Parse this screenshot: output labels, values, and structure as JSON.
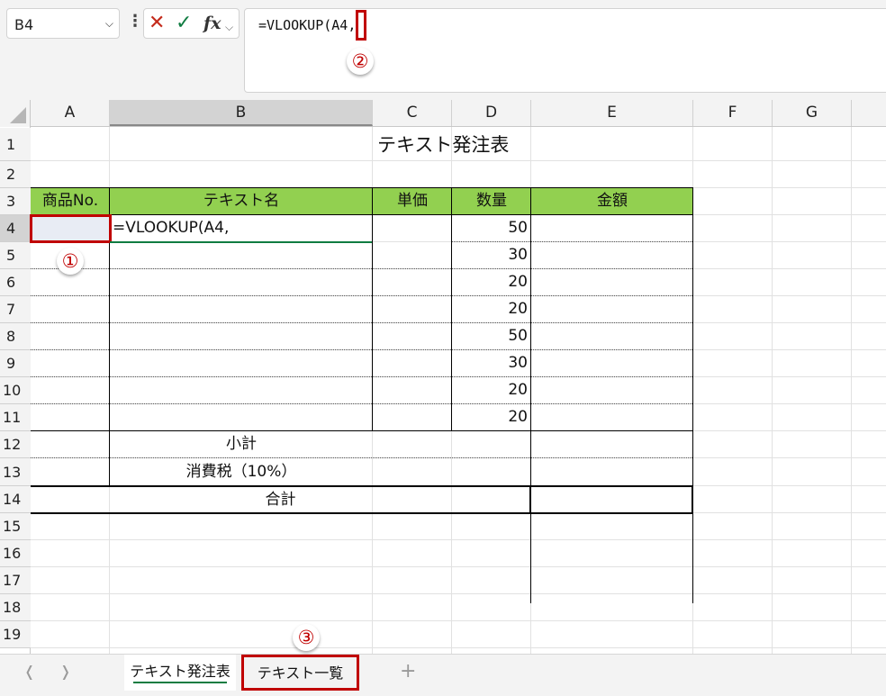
{
  "formula_bar": {
    "name_box": "B4",
    "cancel_icon": "cancel-x-icon",
    "enter_icon": "check-icon",
    "fx_label": "fx",
    "formula": "=VLOOKUP(A4,"
  },
  "columns": [
    "A",
    "B",
    "C",
    "D",
    "E",
    "F",
    "G"
  ],
  "rows": [
    "1",
    "2",
    "3",
    "4",
    "5",
    "6",
    "7",
    "8",
    "9",
    "10",
    "11",
    "12",
    "13",
    "14",
    "15",
    "16",
    "17",
    "18",
    "19"
  ],
  "sheet": {
    "title": "テキスト発注表",
    "headers": {
      "product_no": "商品No.",
      "text_name": "テキスト名",
      "unit_price": "単価",
      "quantity": "数量",
      "amount": "金額"
    },
    "editing_cell": "=VLOOKUP(A4,",
    "quantities": [
      "50",
      "30",
      "20",
      "20",
      "50",
      "30",
      "20",
      "20"
    ],
    "subtotal_label": "小計",
    "tax_label": "消費税（10%）",
    "total_label": "合計",
    "header_fill": "#92d050"
  },
  "annotations": {
    "marker1": "①",
    "marker2": "②",
    "marker3": "③",
    "highlight_color": "#c00000"
  },
  "tabs": {
    "prev_icon": "chevron-left-icon",
    "next_icon": "chevron-right-icon",
    "sheet1": "テキスト発注表",
    "sheet2": "テキスト一覧",
    "add_icon": "plus-icon"
  }
}
